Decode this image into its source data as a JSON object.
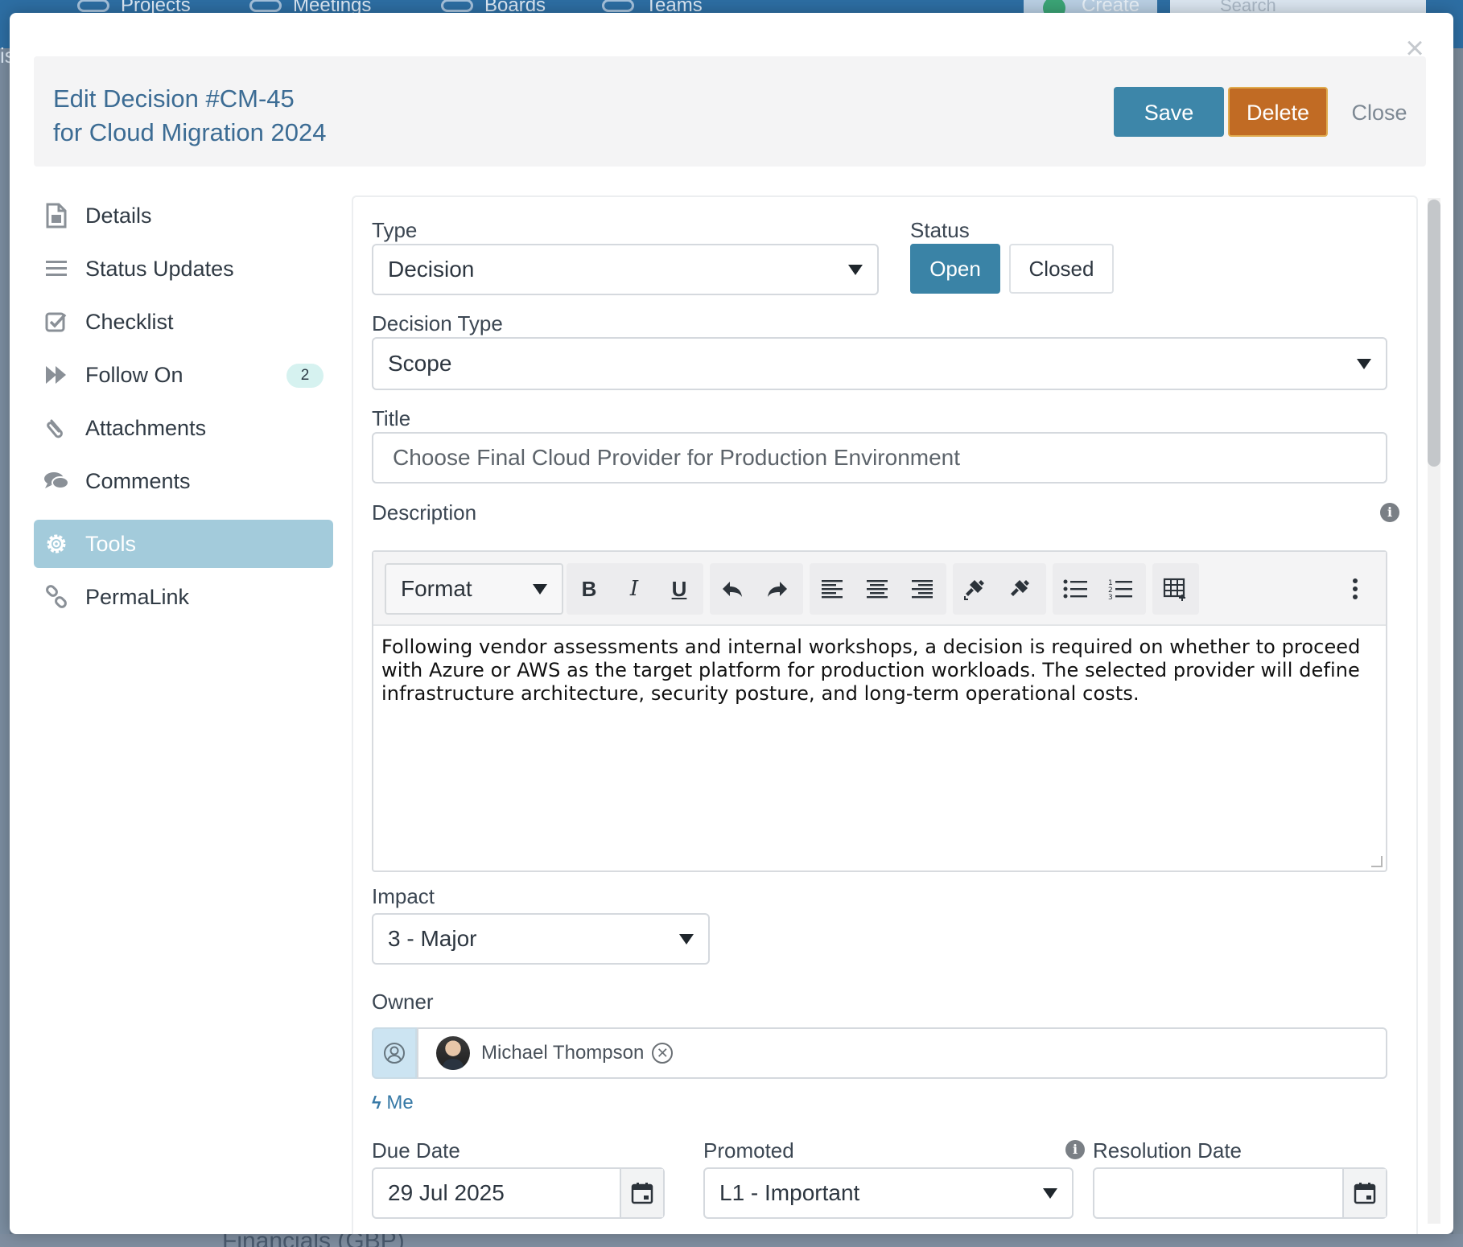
{
  "background": {
    "nav_items": [
      "Projects",
      "Meetings",
      "Boards",
      "Teams"
    ],
    "create_label": "Create",
    "search_placeholder": "Search",
    "side_label": "is",
    "bottom_text": "Financials (GBP)"
  },
  "modal": {
    "title_line1": "Edit Decision #CM-45",
    "title_line2": "for Cloud Migration 2024",
    "save_label": "Save",
    "delete_label": "Delete",
    "close_label": "Close",
    "close_x": "×"
  },
  "sidebar": {
    "items": [
      {
        "label": "Details",
        "icon": "document-icon"
      },
      {
        "label": "Status Updates",
        "icon": "list-icon"
      },
      {
        "label": "Checklist",
        "icon": "checkbox-icon"
      },
      {
        "label": "Follow On",
        "icon": "fast-forward-icon",
        "badge": "2"
      },
      {
        "label": "Attachments",
        "icon": "paperclip-icon"
      },
      {
        "label": "Comments",
        "icon": "comments-icon"
      },
      {
        "label": "Tools",
        "icon": "gear-icon",
        "active": true
      },
      {
        "label": "PermaLink",
        "icon": "link-icon"
      }
    ]
  },
  "form": {
    "type_label": "Type",
    "type_value": "Decision",
    "status_label": "Status",
    "status_open": "Open",
    "status_closed": "Closed",
    "decision_type_label": "Decision Type",
    "decision_type_value": "Scope",
    "title_label": "Title",
    "title_value": "Choose Final Cloud Provider for Production Environment",
    "description_label": "Description",
    "editor": {
      "format_label": "Format",
      "text": "Following vendor assessments and internal workshops, a decision is required on whether to proceed with Azure or AWS as the target platform for production workloads. The selected provider will define infrastructure architecture, security posture, and long-term operational costs."
    },
    "impact_label": "Impact",
    "impact_value": "3 - Major",
    "owner_label": "Owner",
    "owner_name": "Michael Thompson",
    "me_link": "Me",
    "due_date_label": "Due Date",
    "due_date_value": "29 Jul 2025",
    "promoted_label": "Promoted",
    "promoted_value": "L1 - Important",
    "resolution_date_label": "Resolution Date",
    "resolution_date_value": ""
  },
  "colors": {
    "accent": "#3d86a9",
    "delete": "#c16b24",
    "active_sidebar": "#a3cbdb",
    "title_text": "#3c6c94",
    "link": "#3779a6"
  }
}
